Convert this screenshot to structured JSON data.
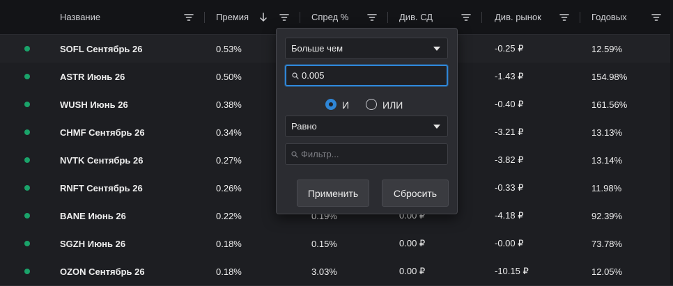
{
  "columns": [
    {
      "label": "Название"
    },
    {
      "label": "Премия"
    },
    {
      "label": "Спред %"
    },
    {
      "label": "Див. СД"
    },
    {
      "label": "Див. рынок"
    },
    {
      "label": "Годовых"
    }
  ],
  "rows": [
    {
      "status": "green",
      "name": "SOFL Сентябрь 26",
      "premium": "0.53%",
      "spread": "",
      "div_sd": "",
      "div_market": "-0.25 ₽",
      "annual": "12.59%"
    },
    {
      "status": "green",
      "name": "ASTR Июнь 26",
      "premium": "0.50%",
      "spread": "",
      "div_sd": "",
      "div_market": "-1.43 ₽",
      "annual": "154.98%"
    },
    {
      "status": "green",
      "name": "WUSH Июнь 26",
      "premium": "0.38%",
      "spread": "",
      "div_sd": "",
      "div_market": "-0.40 ₽",
      "annual": "161.56%"
    },
    {
      "status": "green",
      "name": "CHMF Сентябрь 26",
      "premium": "0.34%",
      "spread": "",
      "div_sd": "",
      "div_market": "-3.21 ₽",
      "annual": "13.13%"
    },
    {
      "status": "green",
      "name": "NVTK Сентябрь 26",
      "premium": "0.27%",
      "spread": "",
      "div_sd": "",
      "div_market": "-3.82 ₽",
      "annual": "13.14%"
    },
    {
      "status": "green",
      "name": "RNFT Сентябрь 26",
      "premium": "0.26%",
      "spread": "",
      "div_sd": "",
      "div_market": "-0.33 ₽",
      "annual": "11.98%"
    },
    {
      "status": "green",
      "name": "BANE Июнь 26",
      "premium": "0.22%",
      "spread": "0.19%",
      "div_sd": "0.00 ₽",
      "div_market": "-4.18 ₽",
      "annual": "92.39%"
    },
    {
      "status": "green",
      "name": "SGZH Июнь 26",
      "premium": "0.18%",
      "spread": "0.15%",
      "div_sd": "0.00 ₽",
      "div_market": "-0.00 ₽",
      "annual": "73.78%"
    },
    {
      "status": "green",
      "name": "OZON Сентябрь 26",
      "premium": "0.18%",
      "spread": "3.03%",
      "div_sd": "0.00 ₽",
      "div_market": "-10.15 ₽",
      "annual": "12.05%"
    }
  ],
  "filter_popup": {
    "condition1": "Больше чем",
    "value1": "0.005",
    "join_and": "И",
    "join_or": "ИЛИ",
    "join_selected": "И",
    "condition2": "Равно",
    "value2_placeholder": "Фильтр...",
    "apply_label": "Применить",
    "reset_label": "Сбросить"
  },
  "colors": {
    "accent": "#2f86d6",
    "status_green": "#1aa36a"
  },
  "icons": {
    "filter": "filter-icon",
    "sort": "arrow-down-icon",
    "search": "search-icon",
    "caret": "chevron-down-icon"
  }
}
